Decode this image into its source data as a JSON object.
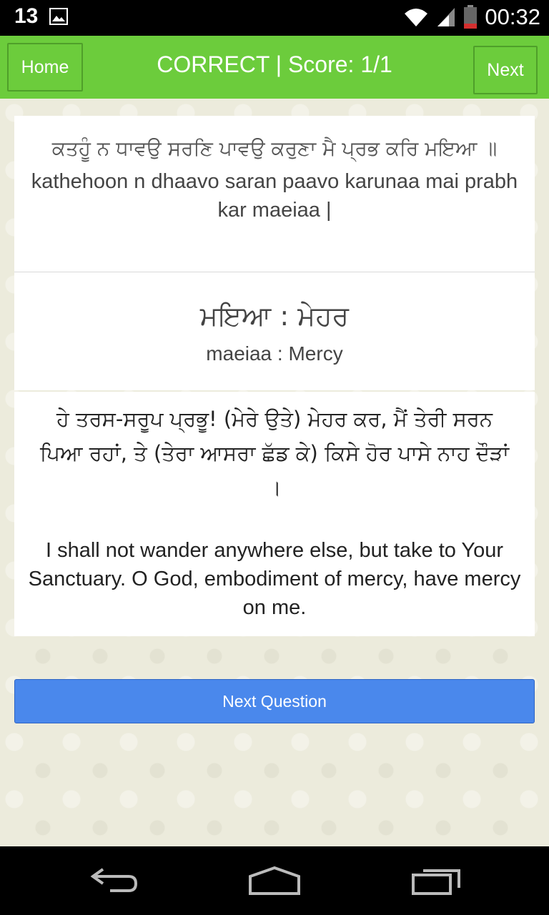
{
  "status_bar": {
    "notification_count": "13",
    "time": "00:32",
    "icons": [
      "image-icon",
      "wifi-icon",
      "signal-icon",
      "battery-icon"
    ]
  },
  "action_bar": {
    "home_label": "Home",
    "title": "CORRECT | Score: 1/1",
    "next_label": "Next"
  },
  "verse": {
    "gurmukhi": "ਕਤਹੂੰ ਨ ਧਾਵਉ ਸਰਣਿ ਪਾਵਉ ਕਰੁਣਾ ਮੈ ਪ੍ਰਭ ਕਰਿ ਮਇਆ ॥",
    "transliteration": "kathehoon n dhaavo saran paavo karunaa mai prabh kar maeiaa |"
  },
  "word": {
    "gurmukhi": "ਮਇਆ : ਮੇਹਰ",
    "transliteration": "maeiaa : Mercy"
  },
  "meaning": {
    "gurmukhi": "ਹੇ ਤਰਸ-ਸਰੂਪ ਪ੍ਰਭੂ! (ਮੇਰੇ ਉਤੇ) ਮੇਹਰ ਕਰ, ਮੈਂ ਤੇਰੀ ਸਰਨ ਪਿਆ ਰਹਾਂ, ਤੇ (ਤੇਰਾ ਆਸਰਾ ਛੱਡ ਕੇ) ਕਿਸੇ ਹੋਰ ਪਾਸੇ ਨਾਹ ਦੌੜਾਂ ।",
    "english": "I shall not wander anywhere else, but take to Your Sanctuary. O God, embodiment of mercy, have mercy on me."
  },
  "next_question_label": "Next Question",
  "nav_bar": {
    "icons": [
      "back-icon",
      "home-icon",
      "recents-icon"
    ]
  },
  "colors": {
    "action_bar": "#6ccc3c",
    "button_blue": "#4a88ec"
  }
}
